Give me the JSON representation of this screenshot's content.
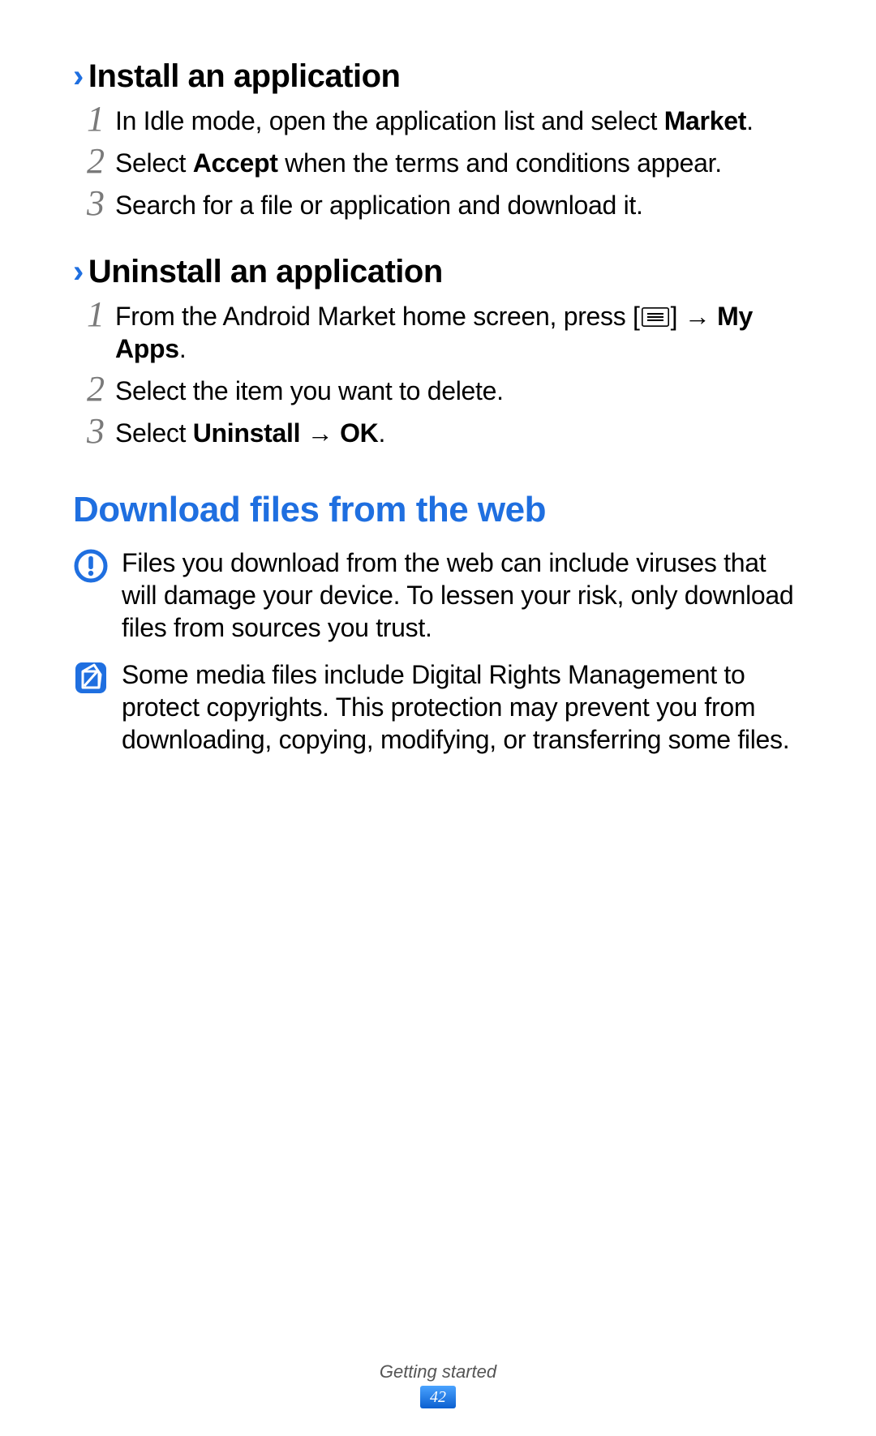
{
  "section_install": {
    "heading": "Install an application",
    "steps": [
      {
        "num": "1",
        "pre": "In Idle mode, open the application list and select ",
        "bold1": "Market",
        "post1": "."
      },
      {
        "num": "2",
        "pre": "Select ",
        "bold1": "Accept",
        "post1": " when the terms and conditions appear."
      },
      {
        "num": "3",
        "pre": "Search for a file or application and download it."
      }
    ]
  },
  "section_uninstall": {
    "heading": "Uninstall an application",
    "steps": [
      {
        "num": "1",
        "pre": "From the Android Market home screen, press [",
        "post_icon": "] → ",
        "bold1": "My Apps",
        "post1": "."
      },
      {
        "num": "2",
        "pre": "Select the item you want to delete."
      },
      {
        "num": "3",
        "pre": "Select ",
        "bold1": "Uninstall",
        "mid": " → ",
        "bold2": "OK",
        "post2": "."
      }
    ]
  },
  "section_download": {
    "heading": "Download files from the web",
    "warning": "Files you download from the web can include viruses that will damage your device. To lessen your risk, only download files from sources you trust.",
    "note": "Some media files include Digital Rights Management to protect copyrights. This protection may prevent you from downloading, copying, modifying, or transferring some files."
  },
  "footer": {
    "label": "Getting started",
    "page": "42"
  }
}
